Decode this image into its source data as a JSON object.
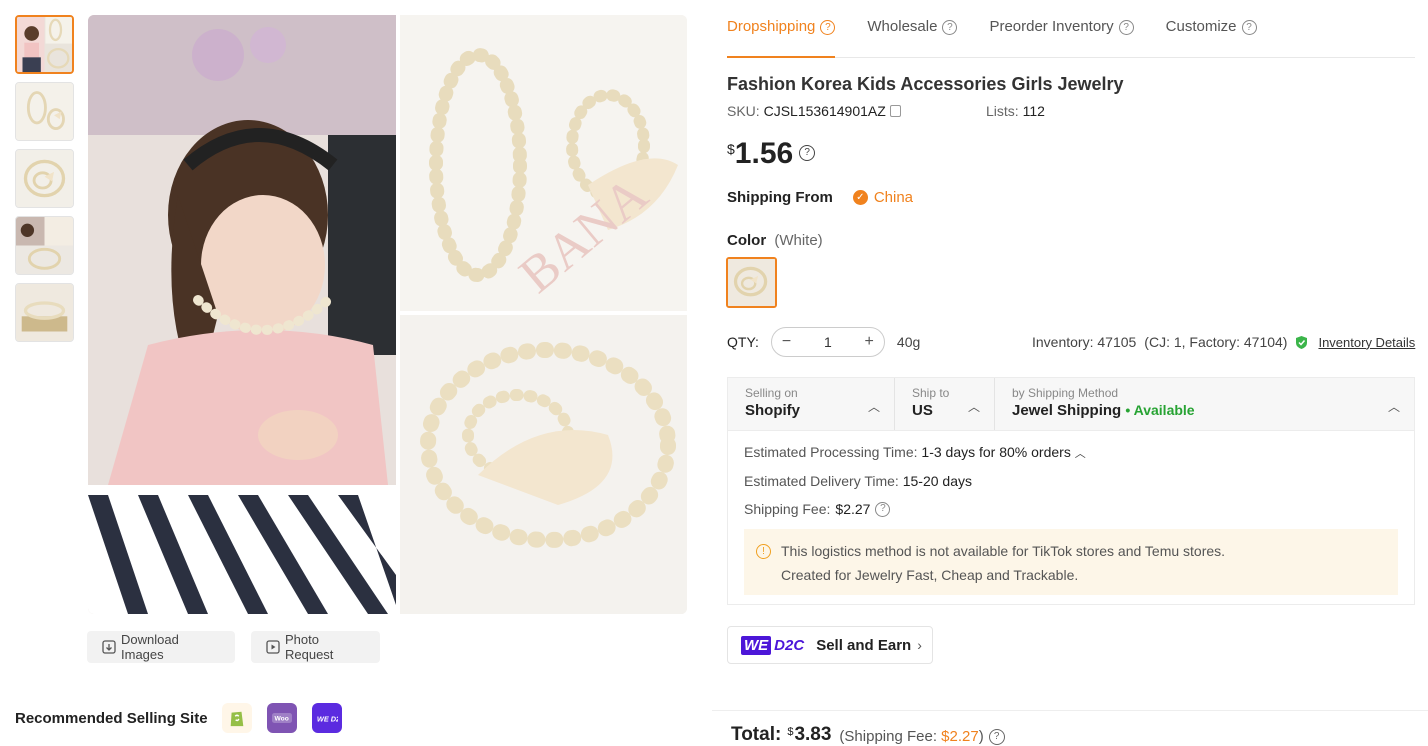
{
  "gallery": {
    "thumb_count": 5,
    "download_label": "Download Images",
    "photo_request_label": "Photo Request",
    "recommended_label": "Recommended Selling Site",
    "sites": [
      "shopify-icon",
      "woocommerce-icon",
      "wed2c-icon"
    ]
  },
  "tabs": [
    {
      "label": "Dropshipping",
      "active": true
    },
    {
      "label": "Wholesale",
      "active": false
    },
    {
      "label": "Preorder Inventory",
      "active": false
    },
    {
      "label": "Customize",
      "active": false
    }
  ],
  "product": {
    "title": "Fashion Korea Kids Accessories Girls Jewelry",
    "sku_label": "SKU:",
    "sku": "CJSL153614901AZ",
    "lists_label": "Lists:",
    "lists": "112",
    "currency": "$",
    "price": "1.56",
    "shipping_from_label": "Shipping From",
    "shipping_from": "China",
    "color_label": "Color",
    "color_value": "(White)"
  },
  "qty": {
    "label": "QTY:",
    "value": "1",
    "weight": "40g",
    "inventory": "Inventory: 47105",
    "inventory_breakdown": "(CJ: 1, Factory: 47104)",
    "inventory_details": "Inventory Details"
  },
  "logistics": {
    "selling_on_label": "Selling on",
    "selling_on": "Shopify",
    "ship_to_label": "Ship to",
    "ship_to": "US",
    "method_label": "by Shipping Method",
    "method": "Jewel Shipping",
    "availability": "• Available",
    "processing_label": "Estimated Processing Time:",
    "processing": "1-3 days for 80% orders",
    "delivery_label": "Estimated Delivery Time:",
    "delivery": "15-20 days",
    "fee_label": "Shipping Fee:",
    "fee": "$2.27",
    "notice_line1": "This logistics method is not available for TikTok stores and Temu stores.",
    "notice_line2": "Created for Jewelry Fast, Cheap and Trackable."
  },
  "sell_earn": {
    "we": "WE",
    "d2c": "D2C",
    "label": "Sell and Earn"
  },
  "total": {
    "label": "Total:",
    "currency": "$",
    "amount": "3.83",
    "fee_prefix": "(Shipping Fee: ",
    "fee": "$2.27",
    "fee_suffix": ")"
  },
  "colors": {
    "accent": "#f0821e",
    "available": "#27a333",
    "brand_d2c": "#4c16d8"
  }
}
